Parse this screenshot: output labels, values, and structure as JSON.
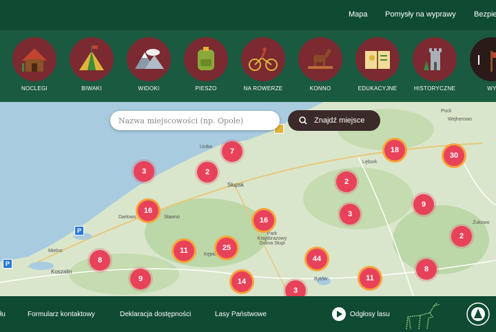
{
  "nav": {
    "map": "Mapa",
    "ideas": "Pomysły na wyprawy",
    "safety": "Bezpie"
  },
  "categories": [
    {
      "label": "NOCLEGI",
      "icon": "cabin-icon"
    },
    {
      "label": "BIWAKI",
      "icon": "tent-icon"
    },
    {
      "label": "WIDOKI",
      "icon": "mountains-icon"
    },
    {
      "label": "PIESZO",
      "icon": "backpack-icon"
    },
    {
      "label": "NA ROWERZE",
      "icon": "cyclist-icon"
    },
    {
      "label": "KONNO",
      "icon": "horse-icon"
    },
    {
      "label": "EDUKACYJNE",
      "icon": "book-icon"
    },
    {
      "label": "HISTORYCZNE",
      "icon": "tower-icon"
    },
    {
      "label": "WY",
      "icon": "signpost-icon"
    }
  ],
  "search": {
    "placeholder": "Nazwa miejscowości (np. Opole)",
    "button": "Znajdź miejsce"
  },
  "places": {
    "ustka": "Ustka",
    "slupsk": "Słupsk",
    "darlowo": "Darłowo",
    "slawno": "Sławno",
    "koszalin": "Koszalin",
    "mielno": "Mielno",
    "kepice": "Kępice",
    "bytow": "Bytów",
    "lebork": "Lębork",
    "wejherowo": "Wejherowo",
    "puck": "Puck",
    "zukowo": "Żukowo",
    "park": "Park Krajobrazowy Dolina Słupi"
  },
  "clusters": [
    "3",
    "7",
    "2",
    "16",
    "16",
    "11",
    "25",
    "8",
    "9",
    "14",
    "3",
    "44",
    "11",
    "2",
    "3",
    "18",
    "9",
    "8",
    "2",
    "30"
  ],
  "footer": {
    "l1": "łu",
    "l2": "Formularz kontaktowy",
    "l3": "Deklaracja dostępności",
    "l4": "Lasy Państwowe",
    "l5": "Odgłosy lasu"
  },
  "colors": {
    "dark_green": "#0f4a32",
    "band_green": "#1a5a40",
    "circle": "#7a2a30",
    "cluster": "#e8425b",
    "cluster_ring": "#f7a33a"
  }
}
